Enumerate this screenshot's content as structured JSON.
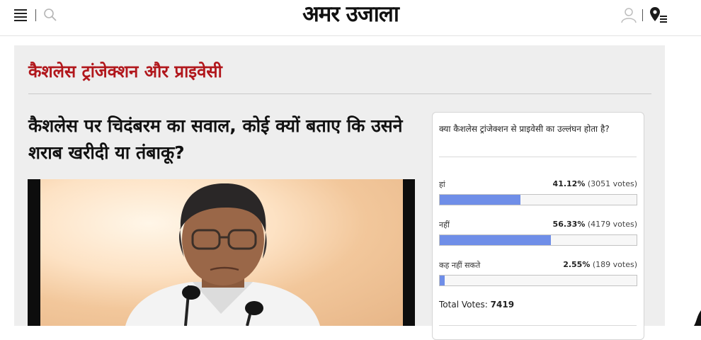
{
  "header": {
    "logo_text": "अमर उजाला",
    "icons": [
      "menu-icon",
      "search-icon",
      "user-icon",
      "location-list-icon"
    ]
  },
  "section": {
    "title": "कैशलेस ट्रांजेक्शन और प्राइवेसी"
  },
  "article": {
    "headline": "कैशलेस पर चिदंबरम का सवाल, कोई क्यों बताए कि उसने शराब खरीदी या तंबाकू?"
  },
  "poll": {
    "question": "क्या कैशलेस ट्रांजेक्शन से प्राइवेसी का उल्लंघन होता है?",
    "options": [
      {
        "label": "हां",
        "percent": "41.12%",
        "votes": "(3051 votes)",
        "fraction": 0.4112
      },
      {
        "label": "नहीं",
        "percent": "56.33%",
        "votes": "(4179 votes)",
        "fraction": 0.5633
      },
      {
        "label": "कह नहीं सकते",
        "percent": "2.55%",
        "votes": "(189 votes)",
        "fraction": 0.0255
      }
    ],
    "total_label": "Total Votes:",
    "total_value": "7419",
    "bar_color": "#6f8ee8"
  },
  "colors": {
    "accent": "#b1171c",
    "background": "#eeeeee"
  }
}
